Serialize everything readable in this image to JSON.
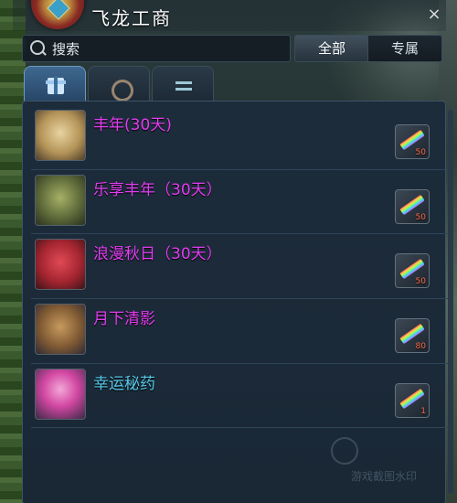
{
  "window": {
    "title": "飞龙工商",
    "close_glyph": "×"
  },
  "search": {
    "placeholder": "搜索",
    "icon": "search-icon"
  },
  "filters": [
    {
      "label": "全部",
      "selected": true
    },
    {
      "label": "专属",
      "selected": false
    }
  ],
  "tabs": [
    {
      "icon": "gift-icon",
      "active": true
    },
    {
      "icon": "scroll-icon",
      "active": false
    },
    {
      "icon": "exchange-icon",
      "active": false
    }
  ],
  "items": [
    {
      "name": "丰年(30天)",
      "price": "50",
      "icon": "robe-icon",
      "name_color": "#e23cf0"
    },
    {
      "name": "乐享丰年（30天）",
      "price": "50",
      "icon": "robe-icon",
      "name_color": "#e23cf0"
    },
    {
      "name": "浪漫秋日（30天）",
      "price": "50",
      "icon": "robe-icon",
      "name_color": "#e23cf0"
    },
    {
      "name": "月下清影",
      "price": "80",
      "icon": "hair-icon",
      "name_color": "#e23cf0"
    },
    {
      "name": "幸运秘药",
      "price": "1",
      "icon": "potion-icon",
      "name_color": "#56c8e8"
    }
  ],
  "watermark": {
    "text": "游戏截图水印"
  },
  "colors": {
    "panel_bg": "#1d2c3b",
    "panel_border": "#3b5467",
    "rare_name": "#e23cf0",
    "common_name": "#56c8e8"
  }
}
